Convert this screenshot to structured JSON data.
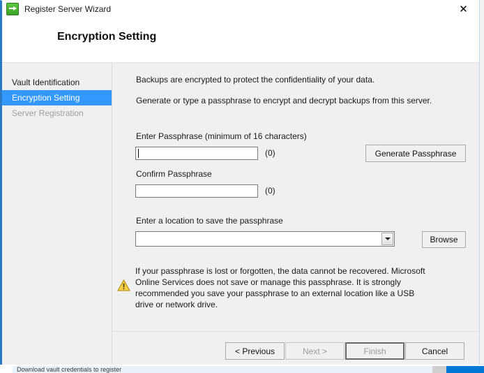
{
  "window": {
    "title": "Register Server Wizard",
    "app_icon": "green-arrow-icon",
    "close_label": "✕"
  },
  "header": {
    "page_title": "Encryption Setting"
  },
  "sidebar": {
    "items": [
      {
        "label": "Vault Identification",
        "state": "normal"
      },
      {
        "label": "Encryption Setting",
        "state": "active"
      },
      {
        "label": "Server Registration",
        "state": "disabled"
      }
    ]
  },
  "main": {
    "intro_line_1": "Backups are encrypted to protect the confidentiality of your data.",
    "intro_line_2": "Generate or type a passphrase to encrypt and decrypt backups from this server.",
    "enter_passphrase": {
      "label": "Enter Passphrase (minimum of 16 characters)",
      "value": "",
      "placeholder": "",
      "counter": "(0)"
    },
    "confirm_passphrase": {
      "label": "Confirm Passphrase",
      "value": "",
      "placeholder": "",
      "counter": "(0)"
    },
    "generate_button": "Generate Passphrase",
    "location": {
      "label": "Enter a location to save the passphrase",
      "value": "",
      "placeholder": "",
      "browse_button": "Browse"
    },
    "warning": {
      "icon": "warning-triangle-icon",
      "text": "If your passphrase is lost or forgotten, the data cannot be recovered. Microsoft Online Services does not save or manage this passphrase. It is strongly recommended you save your passphrase to an external location like a USB drive or network drive."
    }
  },
  "footer": {
    "previous": "< Previous",
    "next": "Next >",
    "finish": "Finish",
    "cancel": "Cancel"
  },
  "background": {
    "row_text": "Download vault credentials to register"
  },
  "colors": {
    "accent": "#3399ff",
    "window_border": "#2b79c2",
    "body": "#f0f0f0",
    "warning": "#f5c518"
  }
}
